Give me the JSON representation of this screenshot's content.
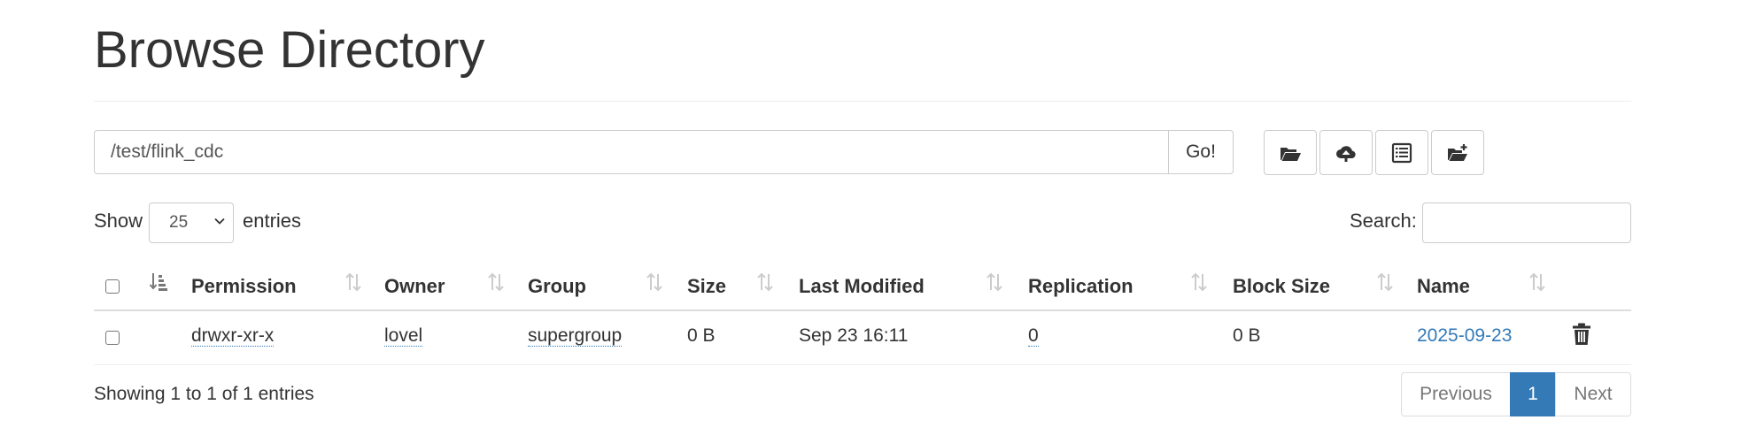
{
  "page_title": "Browse Directory",
  "path_bar": {
    "value": "/test/flink_cdc",
    "go_label": "Go!"
  },
  "toolbar": {
    "icons": [
      "folder-open-icon",
      "cloud-upload-icon",
      "list-alt-icon",
      "create-directory-icon"
    ]
  },
  "length_menu": {
    "show_label": "Show",
    "selected": "25",
    "entries_label": "entries"
  },
  "search": {
    "label": "Search:",
    "value": ""
  },
  "table": {
    "columns": [
      "Permission",
      "Owner",
      "Group",
      "Size",
      "Last Modified",
      "Replication",
      "Block Size",
      "Name"
    ],
    "rows": [
      {
        "permission": "drwxr-xr-x",
        "owner": "lovel",
        "group": "supergroup",
        "size": "0 B",
        "last_modified": "Sep 23 16:11",
        "replication": "0",
        "block_size": "0 B",
        "name": "2025-09-23"
      }
    ]
  },
  "info_text": "Showing 1 to 1 of 1 entries",
  "pagination": {
    "previous": "Previous",
    "current": "1",
    "next": "Next"
  },
  "colors": {
    "link": "#337ab7",
    "active_page": "#337ab7",
    "border": "#cccccc"
  }
}
